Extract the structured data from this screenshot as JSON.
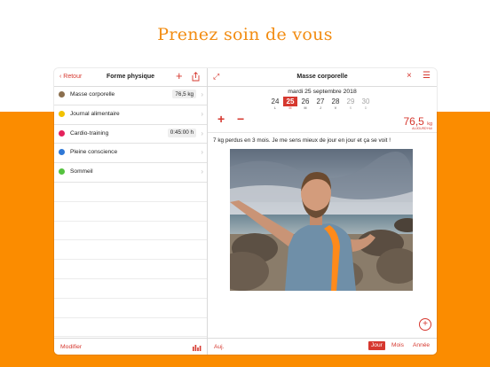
{
  "headline": "Prenez soin de vous",
  "sidebar": {
    "back_label": "Retour",
    "title": "Forme physique",
    "add_label": "+",
    "items": [
      {
        "label": "Masse corporelle",
        "value": "76,5 kg",
        "color": "#8b6f4e"
      },
      {
        "label": "Journal alimentaire",
        "value": "",
        "color": "#f2c200"
      },
      {
        "label": "Cardio-training",
        "value": "0:45:00 h",
        "color": "#e4225c"
      },
      {
        "label": "Pleine conscience",
        "value": "",
        "color": "#2f78d6"
      },
      {
        "label": "Sommeil",
        "value": "",
        "color": "#55c23f"
      }
    ],
    "modify_label": "Modifier"
  },
  "main": {
    "title": "Masse corporelle",
    "close_label": "×",
    "menu_label": "☰",
    "date_label": "mardi 25 septembre 2018",
    "days": [
      {
        "n": "24",
        "w": "L",
        "state": "normal"
      },
      {
        "n": "25",
        "w": "M",
        "state": "selected"
      },
      {
        "n": "26",
        "w": "M",
        "state": "normal"
      },
      {
        "n": "27",
        "w": "J",
        "state": "normal"
      },
      {
        "n": "28",
        "w": "V",
        "state": "normal"
      },
      {
        "n": "29",
        "w": "S",
        "state": "dim"
      },
      {
        "n": "30",
        "w": "D",
        "state": "dim"
      }
    ],
    "plus_label": "+",
    "minus_label": "−",
    "weight_value": "76,5",
    "weight_unit": "kg",
    "weight_sub": "AUJOURD'HUI",
    "note": "7 kg perdus en 3 mois. Je me sens mieux de jour en jour et ça se voit !",
    "add_button": "+",
    "today_label": "Auj.",
    "segments": [
      "Jour",
      "Mois",
      "Année"
    ],
    "active_segment": "Jour"
  },
  "colors": {
    "accent": "#d6382f",
    "orange": "#fb8c00",
    "headline": "#f28c12"
  }
}
